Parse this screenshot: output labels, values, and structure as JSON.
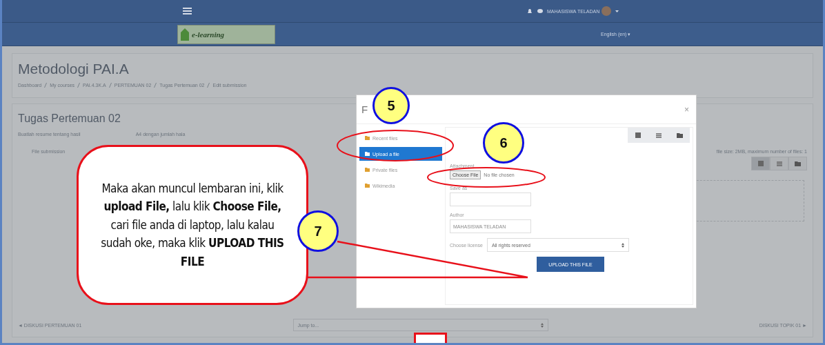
{
  "navbar": {
    "user": "MAHASISWA TELADAN",
    "logo": "e-learning",
    "language": "English (en) ▾"
  },
  "page": {
    "title": "Metodologi PAI.A",
    "breadcrumb": [
      "Dashboard",
      "My courses",
      "PAI.4.3K.A",
      "PERTEMUAN 02",
      "Tugas Pertemuan 02",
      "Edit submission"
    ]
  },
  "assignment": {
    "title": "Tugas Pertemuan 02",
    "description": [
      "Buatlah resume tentang hasil",
      "A4 dengan jumlah hala"
    ],
    "field_label": "File submission",
    "limits": "file size: 2MB, maximum number of files: 1"
  },
  "footer": {
    "previous": "◄ DISKUSI PERTEMUAN 01",
    "jump": "Jump to...",
    "next": "DISKUSI TOPIK 01 ►"
  },
  "dialog": {
    "title": "F",
    "close": "×",
    "repositories": [
      {
        "label": "Recent files",
        "selected": false
      },
      {
        "label": "Upload a file",
        "selected": true
      },
      {
        "label": "Private files",
        "selected": false
      },
      {
        "label": "Wikimedia",
        "selected": false
      }
    ],
    "attachment_label": "Attachment",
    "choose_button": "Choose File",
    "no_file": "No file chosen",
    "save_as_label": "Save as",
    "author_label": "Author",
    "author_value": "MAHASISWA TELADAN",
    "license_label": "Choose license",
    "license_value": "All rights reserved",
    "upload_button": "UPLOAD THIS FILE"
  },
  "callout": {
    "text": "Maka akan muncul lembaran ini, klik **upload File,** lalu klik **Choose File,** cari file anda di laptop, lalu kalau sudah oke, maka klik **UPLOAD THIS FILE**"
  },
  "steps": [
    "5",
    "6",
    "7"
  ]
}
